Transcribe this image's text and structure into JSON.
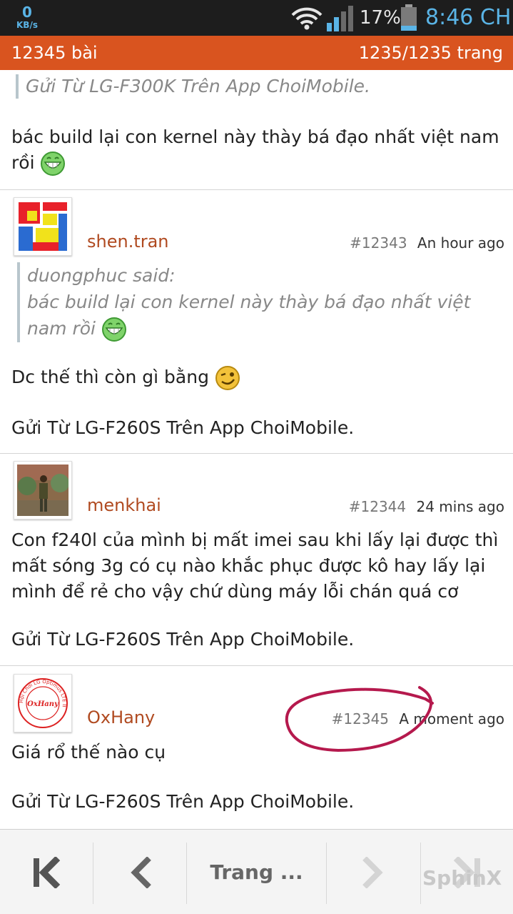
{
  "status_bar": {
    "data_speed_value": "0",
    "data_speed_unit": "KB/s",
    "battery_percent": "17%",
    "time": "8:46 CH"
  },
  "header": {
    "post_count": "12345 bài",
    "page_position": "1235/1235 trang"
  },
  "posts": {
    "prev": {
      "signature": "Gửi Từ LG-F300K Trên App ChoiMobile.",
      "body": "bác build lại con kernel này thày bá đạo nhất việt nam rồi"
    },
    "p1": {
      "username": "shen.tran",
      "post_number": "#12343",
      "time": "An hour ago",
      "quote_author": "duongphuc said:",
      "quote_text": "bác build lại con kernel này thày bá đạo nhất việt nam rồi",
      "body": "Dc thế thì còn gì bằng",
      "signature": "Gửi Từ LG-F260S Trên App ChoiMobile."
    },
    "p2": {
      "username": "menkhai",
      "post_number": "#12344",
      "time": "24 mins ago",
      "body": "Con f240l của mình bị mất imei sau khi lấy lại được thì mất sóng 3g có cụ nào khắc phục được kô hay lấy lại mình để rẻ cho vậy chứ dùng máy lỗi chán quá cơ",
      "signature": "Gửi Từ LG-F260S Trên App ChoiMobile."
    },
    "p3": {
      "username": "OxHany",
      "post_number": "#12345",
      "time": "A moment ago",
      "body": "Giá rổ thế nào cụ",
      "signature": "Gửi Từ LG-F260S Trên App ChoiMobile."
    }
  },
  "avatar_stamp": {
    "center": "OxHany",
    "ring_text": "Hội Chơi LG Optimus LTE II"
  },
  "nav": {
    "page_button_label": "Trang ...",
    "watermark": "SphinX"
  },
  "colors": {
    "header_bg": "#d9541f",
    "username": "#b04a20",
    "status_accent": "#5ab4e6",
    "annotation": "#b5194d"
  }
}
